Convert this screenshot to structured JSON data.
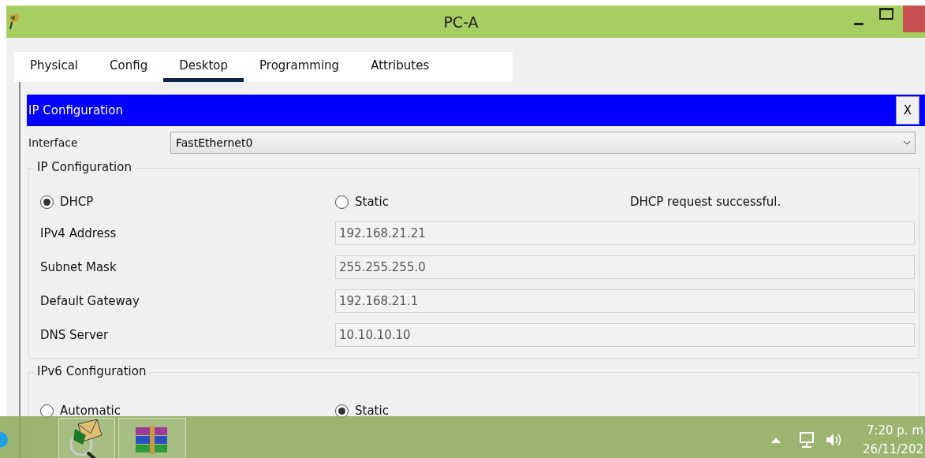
{
  "window": {
    "title": "PC-A"
  },
  "tabs": [
    {
      "label": "Physical",
      "selected": false
    },
    {
      "label": "Config",
      "selected": false
    },
    {
      "label": "Desktop",
      "selected": true
    },
    {
      "label": "Programming",
      "selected": false
    },
    {
      "label": "Attributes",
      "selected": false
    }
  ],
  "panel": {
    "title": "IP Configuration",
    "close": "X"
  },
  "interface": {
    "label": "Interface",
    "value": "FastEthernet0"
  },
  "ipv4": {
    "title": "IP Configuration",
    "modes": [
      {
        "label": "DHCP",
        "selected": true
      },
      {
        "label": "Static",
        "selected": false
      }
    ],
    "status": "DHCP request successful.",
    "fields": [
      {
        "label": "IPv4 Address",
        "value": "192.168.21.21"
      },
      {
        "label": "Subnet Mask",
        "value": "255.255.255.0"
      },
      {
        "label": "Default Gateway",
        "value": "192.168.21.1"
      },
      {
        "label": "DNS Server",
        "value": "10.10.10.10"
      }
    ]
  },
  "ipv6": {
    "title": "IPv6 Configuration",
    "modes": [
      {
        "label": "Automatic",
        "selected": false
      },
      {
        "label": "Static",
        "selected": true
      }
    ]
  },
  "taskbar": {
    "time": "7:20 p. m",
    "date": "26/11/202"
  }
}
